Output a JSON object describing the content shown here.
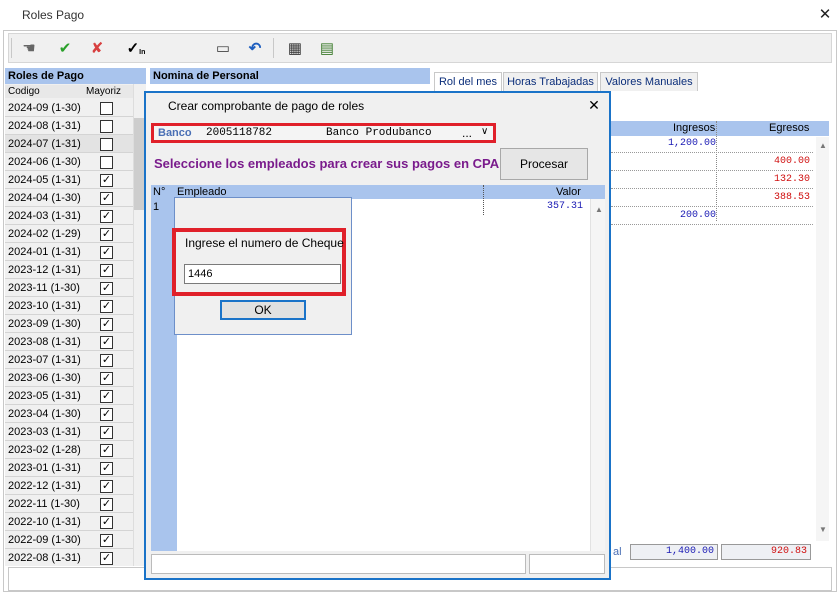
{
  "window": {
    "title": "Roles Pago",
    "close_glyph": "✕"
  },
  "toolbar": {
    "buttons": [
      {
        "name": "hand-icon",
        "glyph": "☚"
      },
      {
        "name": "check-icon",
        "glyph": "✔"
      },
      {
        "name": "x-icon",
        "glyph": "✘"
      },
      {
        "name": "check-in-icon",
        "glyph": "✓"
      },
      {
        "name": "window-icon",
        "glyph": "▭"
      },
      {
        "name": "undo-icon",
        "glyph": "↶"
      },
      {
        "name": "calculator-icon",
        "glyph": "▦"
      },
      {
        "name": "report-icon",
        "glyph": "▤"
      }
    ],
    "check_in_suffix": "In"
  },
  "left": {
    "header": "Roles de Pago",
    "col_code": "Codigo",
    "col_mayoriz": "Mayoriz",
    "rows": [
      {
        "code": "2024-09 (1-30)",
        "checked": false
      },
      {
        "code": "2024-08 (1-31)",
        "checked": false
      },
      {
        "code": "2024-07 (1-31)",
        "checked": false
      },
      {
        "code": "2024-06 (1-30)",
        "checked": false
      },
      {
        "code": "2024-05 (1-31)",
        "checked": true
      },
      {
        "code": "2024-04 (1-30)",
        "checked": true
      },
      {
        "code": "2024-03 (1-31)",
        "checked": true
      },
      {
        "code": "2024-02 (1-29)",
        "checked": true
      },
      {
        "code": "2024-01 (1-31)",
        "checked": true
      },
      {
        "code": "2023-12 (1-31)",
        "checked": true
      },
      {
        "code": "2023-11 (1-30)",
        "checked": true
      },
      {
        "code": "2023-10 (1-31)",
        "checked": true
      },
      {
        "code": "2023-09 (1-30)",
        "checked": true
      },
      {
        "code": "2023-08 (1-31)",
        "checked": true
      },
      {
        "code": "2023-07 (1-31)",
        "checked": true
      },
      {
        "code": "2023-06 (1-30)",
        "checked": true
      },
      {
        "code": "2023-05 (1-31)",
        "checked": true
      },
      {
        "code": "2023-04 (1-30)",
        "checked": true
      },
      {
        "code": "2023-03 (1-31)",
        "checked": true
      },
      {
        "code": "2023-02 (1-28)",
        "checked": true
      },
      {
        "code": "2023-01 (1-31)",
        "checked": true
      },
      {
        "code": "2022-12 (1-31)",
        "checked": true
      },
      {
        "code": "2022-11 (1-30)",
        "checked": true
      },
      {
        "code": "2022-10 (1-31)",
        "checked": true
      },
      {
        "code": "2022-09 (1-30)",
        "checked": true
      },
      {
        "code": "2022-08 (1-31)",
        "checked": true
      }
    ]
  },
  "nomina": {
    "header": "Nomina de Personal"
  },
  "tabs": [
    "Rol del mes",
    "Horas Trabajadas",
    "Valores Manuales"
  ],
  "grid": {
    "col_ingresos": "Ingresos",
    "col_egresos": "Egresos",
    "ingresos": [
      "1,200.00",
      "",
      "",
      "",
      "200.00"
    ],
    "egresos": [
      "",
      "400.00",
      "132.30",
      "388.53",
      ""
    ],
    "total_label": "al",
    "total_ingresos": "1,400.00",
    "total_egresos": "920.83"
  },
  "dialog": {
    "title": "Crear comprobante de pago de roles",
    "close_glyph": "✕",
    "banco_label": "Banco",
    "banco_account": "2005118782",
    "banco_name": "Banco Produbanco",
    "banco_dots": "...",
    "banco_chevron": "∨",
    "instruction": "Seleccione los empleados para crear sus pagos en CPA",
    "procesar_label": "Procesar",
    "col_num": "N°",
    "col_empleado": "Empleado",
    "col_valor": "Valor",
    "row_num": "1",
    "row_valor": "357.31"
  },
  "prompt": {
    "label": "Ingrese el numero de Cheque",
    "value": "1446",
    "ok_label": "OK"
  }
}
